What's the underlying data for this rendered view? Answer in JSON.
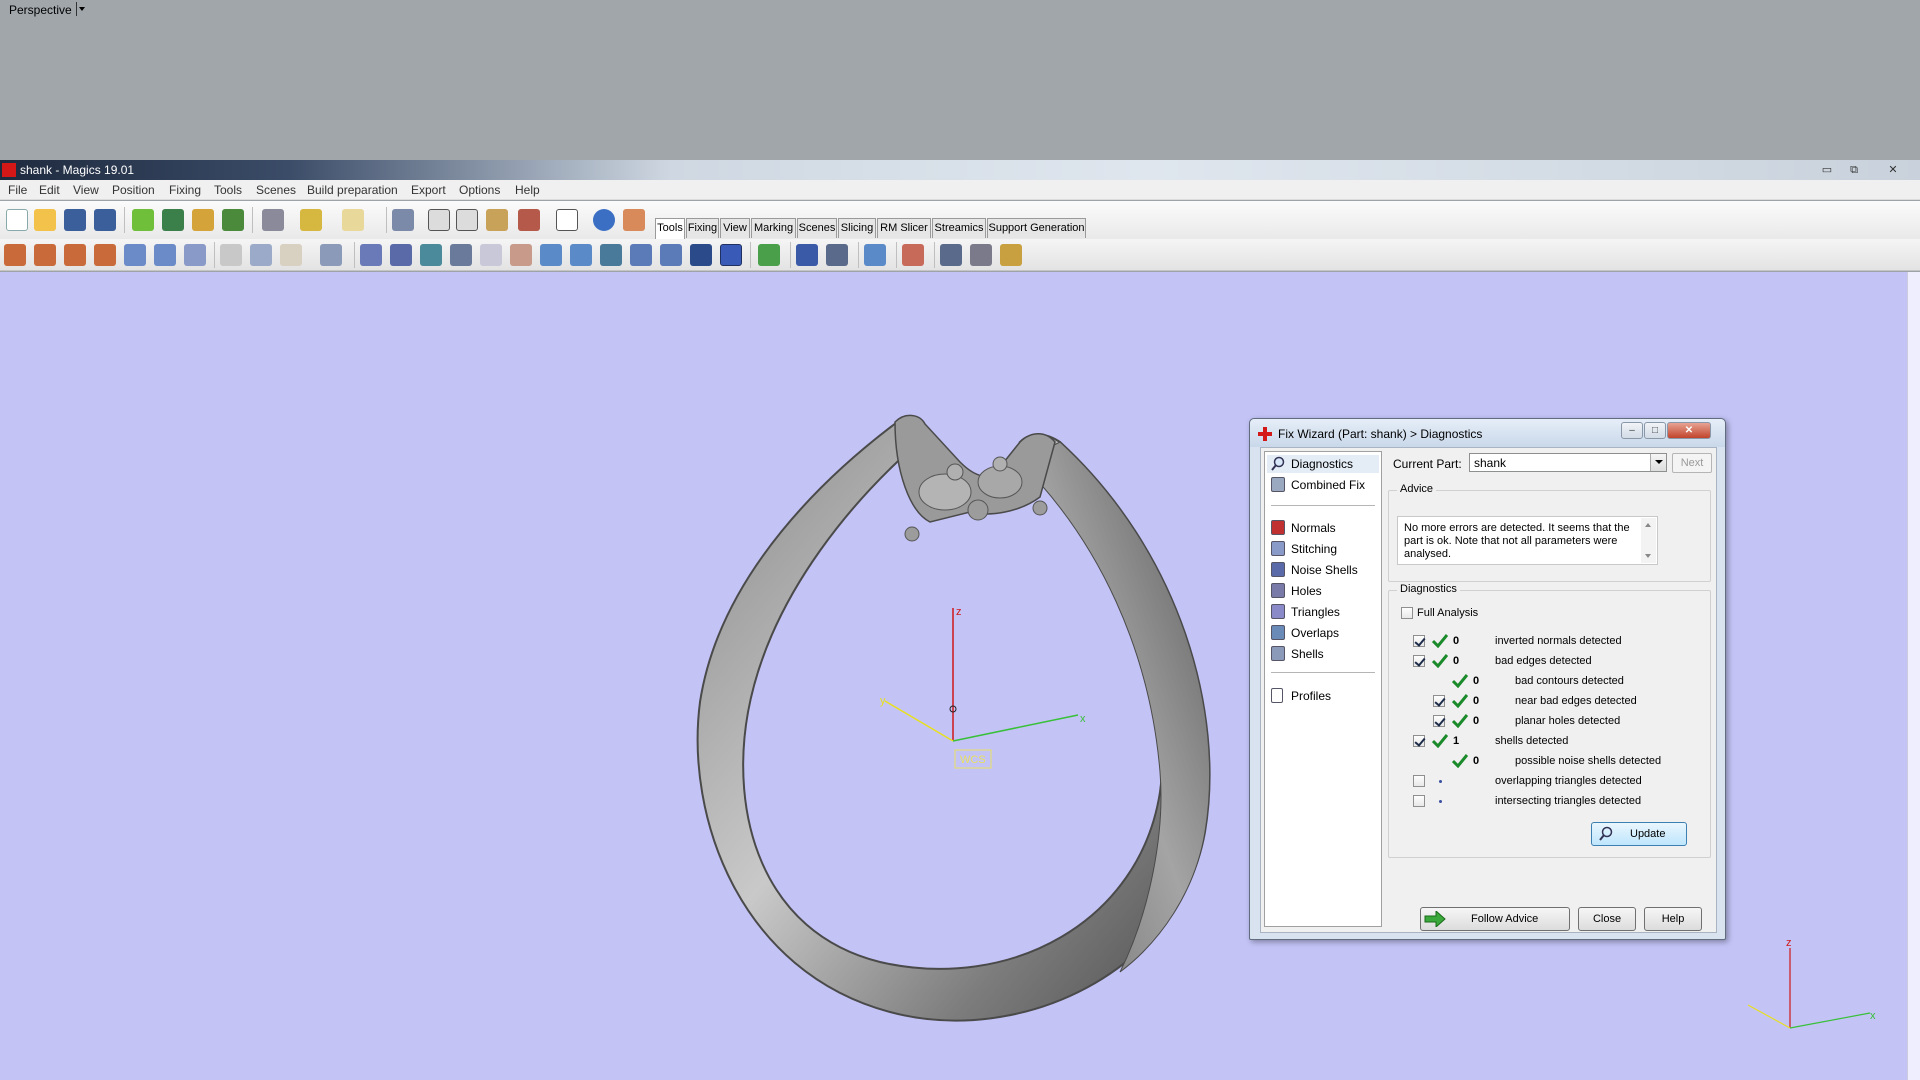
{
  "viewport_label": "Perspective",
  "window": {
    "title": "shank - Magics 19.01",
    "minimize": "▭",
    "restore": "⧉",
    "close": "✕"
  },
  "menu": [
    "File",
    "Edit",
    "View",
    "Position",
    "Fixing",
    "Tools",
    "Scenes",
    "Build preparation",
    "Export",
    "Options",
    "Help"
  ],
  "toolbar_tabs": [
    "Tools",
    "Fixing",
    "View",
    "Marking",
    "Scenes",
    "Slicing",
    "RM Slicer",
    "Streamics",
    "Support Generation"
  ],
  "active_tab": "Tools",
  "axes": {
    "z": "z",
    "x": "x",
    "y": "y",
    "wcs": "WCS"
  },
  "colors": {
    "viewport_bg": "#c3c3f6",
    "axis_x": "#38c038",
    "axis_y": "#e8e020",
    "axis_z": "#d01818",
    "ok_green": "#1a8a2a"
  },
  "dialog": {
    "title": "Fix Wizard (Part: shank) > Diagnostics",
    "nav": {
      "top": [
        {
          "label": "Diagnostics",
          "icon": "magnifier-icon",
          "selected": true
        },
        {
          "label": "Combined Fix",
          "icon": "cube-icon"
        }
      ],
      "middle": [
        {
          "label": "Normals",
          "icon": "normals-icon"
        },
        {
          "label": "Stitching",
          "icon": "stitching-icon"
        },
        {
          "label": "Noise Shells",
          "icon": "noise-shells-icon"
        },
        {
          "label": "Holes",
          "icon": "holes-icon"
        },
        {
          "label": "Triangles",
          "icon": "triangles-icon"
        },
        {
          "label": "Overlaps",
          "icon": "overlaps-icon"
        },
        {
          "label": "Shells",
          "icon": "shells-icon"
        }
      ],
      "bottom": [
        {
          "label": "Profiles",
          "icon": "document-icon"
        }
      ]
    },
    "current_part_label": "Current Part:",
    "current_part_value": "shank",
    "next_label": "Next",
    "advice_title": "Advice",
    "advice_text": "No more errors are detected. It seems that the part is ok. Note that not all parameters were analysed.",
    "diagnostics_title": "Diagnostics",
    "full_analysis_label": "Full Analysis",
    "full_analysis_checked": false,
    "rows": [
      {
        "level": 0,
        "checkbox": true,
        "checked": true,
        "status": "ok",
        "count": "0",
        "label": "inverted normals detected"
      },
      {
        "level": 0,
        "checkbox": true,
        "checked": true,
        "status": "ok",
        "count": "0",
        "label": "bad edges detected"
      },
      {
        "level": 1,
        "checkbox": false,
        "checked": false,
        "status": "ok",
        "count": "0",
        "label": "bad contours detected"
      },
      {
        "level": 1,
        "checkbox": true,
        "checked": true,
        "status": "ok",
        "count": "0",
        "label": "near bad edges detected"
      },
      {
        "level": 1,
        "checkbox": true,
        "checked": true,
        "status": "ok",
        "count": "0",
        "label": "planar holes detected"
      },
      {
        "level": 0,
        "checkbox": true,
        "checked": true,
        "status": "ok",
        "count": "1",
        "label": "shells detected"
      },
      {
        "level": 1,
        "checkbox": false,
        "checked": false,
        "status": "ok",
        "count": "0",
        "label": "possible noise shells detected"
      },
      {
        "level": 0,
        "checkbox": true,
        "checked": false,
        "status": "none",
        "count": "",
        "label": "overlapping triangles detected"
      },
      {
        "level": 0,
        "checkbox": true,
        "checked": false,
        "status": "none",
        "count": "",
        "label": "intersecting triangles detected"
      }
    ],
    "update_label": "Update",
    "follow_advice_label": "Follow Advice",
    "close_label": "Close",
    "help_label": "Help"
  }
}
